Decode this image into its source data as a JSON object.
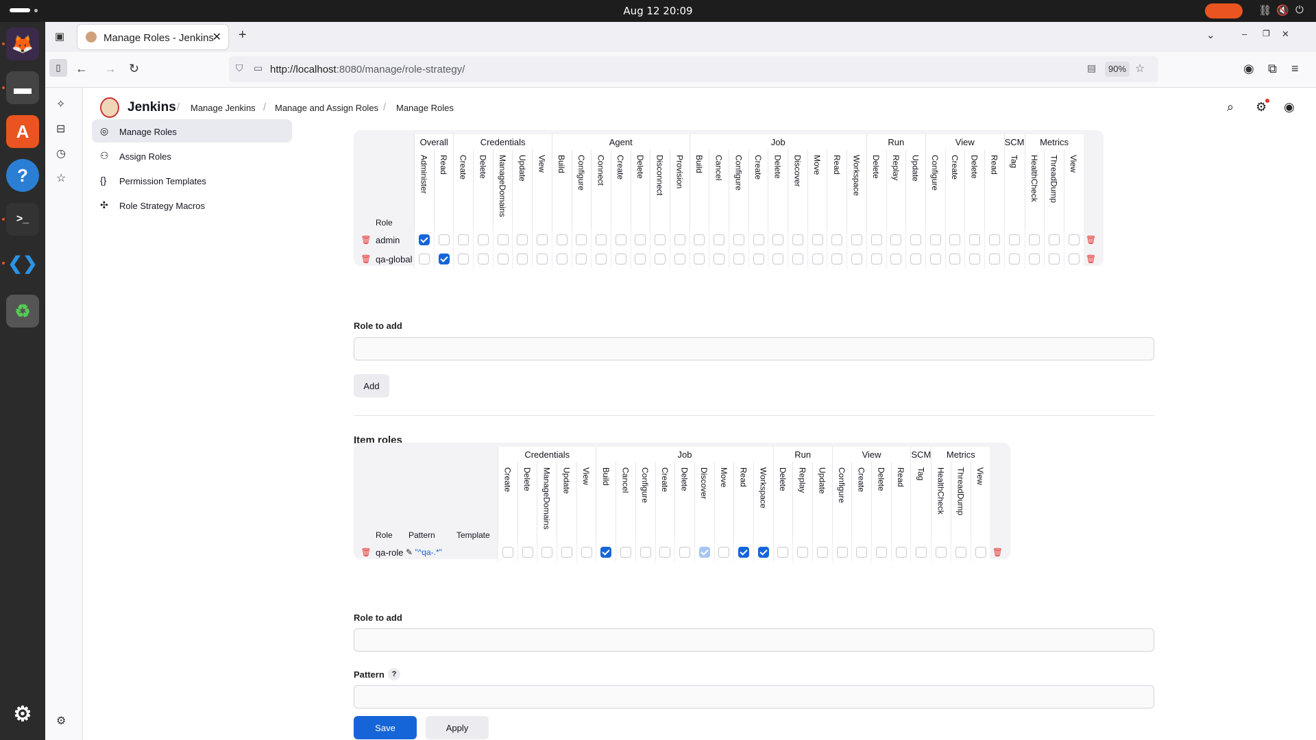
{
  "system": {
    "clock": "Aug 12  20:09"
  },
  "browser": {
    "tab_title": "Manage Roles - Jenkins",
    "url_host": "http://localhost",
    "url_path": ":8080/manage/role-strategy/",
    "zoom": "90%"
  },
  "header": {
    "brand": "Jenkins",
    "breadcrumbs": [
      "Manage Jenkins",
      "Manage and Assign Roles",
      "Manage Roles"
    ]
  },
  "sidebar": {
    "items": [
      {
        "label": "Manage Roles",
        "icon": "fingerprint-icon",
        "active": true
      },
      {
        "label": "Assign Roles",
        "icon": "users-icon",
        "active": false
      },
      {
        "label": "Permission Templates",
        "icon": "braces-icon",
        "active": false
      },
      {
        "label": "Role Strategy Macros",
        "icon": "puzzle-icon",
        "active": false
      }
    ]
  },
  "global_roles": {
    "role_header": "Role",
    "groups": [
      {
        "name": "Overall",
        "perms": [
          "Administer",
          "Read"
        ]
      },
      {
        "name": "Credentials",
        "perms": [
          "Create",
          "Delete",
          "ManageDomains",
          "Update",
          "View"
        ]
      },
      {
        "name": "Agent",
        "perms": [
          "Build",
          "Configure",
          "Connect",
          "Create",
          "Delete",
          "Disconnect",
          "Provision"
        ]
      },
      {
        "name": "Job",
        "perms": [
          "Build",
          "Cancel",
          "Configure",
          "Create",
          "Delete",
          "Discover",
          "Move",
          "Read",
          "Workspace"
        ]
      },
      {
        "name": "Run",
        "perms": [
          "Delete",
          "Replay",
          "Update"
        ]
      },
      {
        "name": "View",
        "perms": [
          "Configure",
          "Create",
          "Delete",
          "Read"
        ]
      },
      {
        "name": "SCM",
        "perms": [
          "Tag"
        ]
      },
      {
        "name": "Metrics",
        "perms": [
          "HealthCheck",
          "ThreadDump",
          "View"
        ]
      }
    ],
    "rows": [
      {
        "name": "admin",
        "checked": [
          0
        ]
      },
      {
        "name": "qa-global",
        "checked": [
          1
        ]
      }
    ],
    "role_to_add_label": "Role to add",
    "add_button": "Add"
  },
  "item_roles": {
    "section_title": "Item roles",
    "role_header": "Role",
    "pattern_header": "Pattern",
    "template_header": "Template",
    "groups": [
      {
        "name": "Credentials",
        "perms": [
          "Create",
          "Delete",
          "ManageDomains",
          "Update",
          "View"
        ]
      },
      {
        "name": "Job",
        "perms": [
          "Build",
          "Cancel",
          "Configure",
          "Create",
          "Delete",
          "Discover",
          "Move",
          "Read",
          "Workspace"
        ]
      },
      {
        "name": "Run",
        "perms": [
          "Delete",
          "Replay",
          "Update"
        ]
      },
      {
        "name": "View",
        "perms": [
          "Configure",
          "Create",
          "Delete",
          "Read"
        ]
      },
      {
        "name": "SCM",
        "perms": [
          "Tag"
        ]
      },
      {
        "name": "Metrics",
        "perms": [
          "HealthCheck",
          "ThreadDump",
          "View"
        ]
      }
    ],
    "rows": [
      {
        "name": "qa-role",
        "pattern": "\"^qa-.*\"",
        "checked": [
          5,
          12,
          13
        ],
        "implied": [
          10
        ]
      }
    ],
    "role_to_add_label": "Role to add",
    "pattern_label": "Pattern",
    "pattern_help": "?"
  },
  "footer": {
    "save": "Save",
    "apply": "Apply"
  },
  "colors": {
    "accent": "#1665d8",
    "danger": "#e5322d"
  }
}
